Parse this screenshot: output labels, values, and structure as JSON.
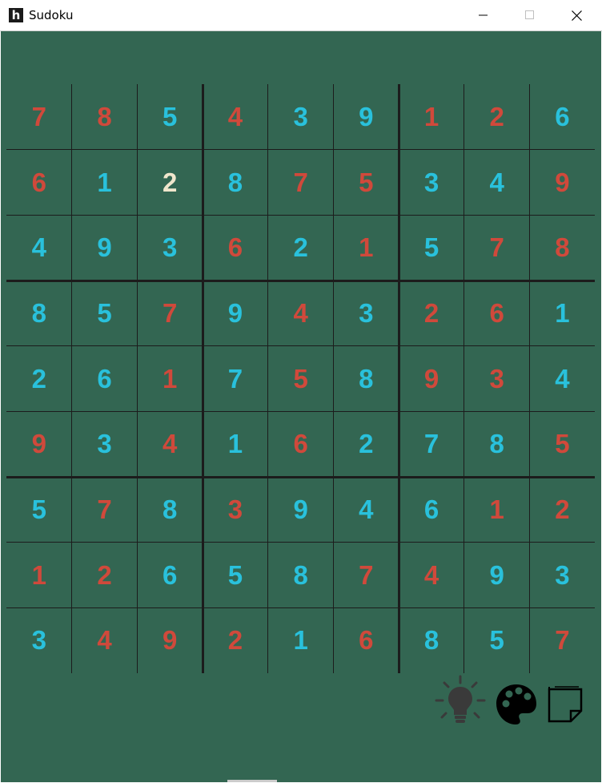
{
  "window": {
    "title": "Sudoku",
    "app_icon_glyph": "h"
  },
  "colors": {
    "background": "#336652",
    "red": "#d0493b",
    "cyan": "#29c1dc",
    "cream": "#f0e6cc",
    "line": "#1c1c1c"
  },
  "board": {
    "rows": [
      [
        "7",
        "8",
        "5",
        "4",
        "3",
        "9",
        "1",
        "2",
        "6"
      ],
      [
        "6",
        "1",
        "2",
        "8",
        "7",
        "5",
        "3",
        "4",
        "9"
      ],
      [
        "4",
        "9",
        "3",
        "6",
        "2",
        "1",
        "5",
        "7",
        "8"
      ],
      [
        "8",
        "5",
        "7",
        "9",
        "4",
        "3",
        "2",
        "6",
        "1"
      ],
      [
        "2",
        "6",
        "1",
        "7",
        "5",
        "8",
        "9",
        "3",
        "4"
      ],
      [
        "9",
        "3",
        "4",
        "1",
        "6",
        "2",
        "7",
        "8",
        "5"
      ],
      [
        "5",
        "7",
        "8",
        "3",
        "9",
        "4",
        "6",
        "1",
        "2"
      ],
      [
        "1",
        "2",
        "6",
        "5",
        "8",
        "7",
        "4",
        "9",
        "3"
      ],
      [
        "3",
        "4",
        "9",
        "2",
        "1",
        "6",
        "8",
        "5",
        "7"
      ]
    ],
    "color_keys": [
      [
        "red",
        "red",
        "cyan",
        "red",
        "cyan",
        "cyan",
        "red",
        "red",
        "cyan"
      ],
      [
        "red",
        "cyan",
        "cream",
        "cyan",
        "red",
        "red",
        "cyan",
        "cyan",
        "red"
      ],
      [
        "cyan",
        "cyan",
        "cyan",
        "red",
        "cyan",
        "red",
        "cyan",
        "red",
        "red"
      ],
      [
        "cyan",
        "cyan",
        "red",
        "cyan",
        "red",
        "cyan",
        "red",
        "red",
        "cyan"
      ],
      [
        "cyan",
        "cyan",
        "red",
        "cyan",
        "red",
        "cyan",
        "red",
        "red",
        "cyan"
      ],
      [
        "red",
        "cyan",
        "red",
        "cyan",
        "red",
        "cyan",
        "cyan",
        "cyan",
        "red"
      ],
      [
        "cyan",
        "red",
        "cyan",
        "red",
        "cyan",
        "cyan",
        "cyan",
        "red",
        "red"
      ],
      [
        "red",
        "red",
        "cyan",
        "cyan",
        "cyan",
        "red",
        "red",
        "cyan",
        "cyan"
      ],
      [
        "cyan",
        "red",
        "red",
        "red",
        "cyan",
        "red",
        "cyan",
        "cyan",
        "red"
      ]
    ],
    "selected": {
      "row": 2,
      "col": 3
    }
  },
  "toolbar": {
    "icons": [
      "hint-lightbulb-icon",
      "theme-palette-icon",
      "notes-icon"
    ]
  }
}
